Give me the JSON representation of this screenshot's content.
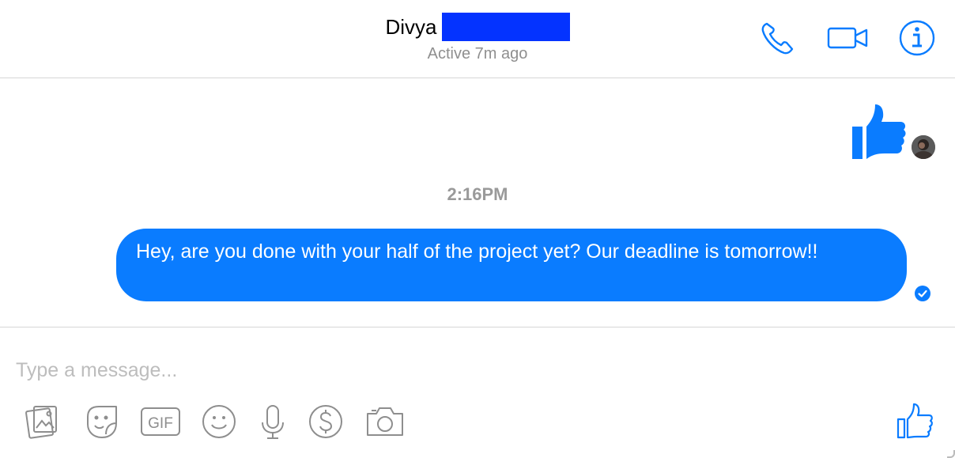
{
  "header": {
    "contact_name": "Divya",
    "redaction_color": "#0433ff",
    "status": "Active 7m ago",
    "icons": [
      "phone-icon",
      "video-camera-icon",
      "info-icon"
    ]
  },
  "thread": {
    "sticker": "thumbs-up-icon",
    "timestamp": "2:16PM",
    "message": "Hey, are you done with your half of the project yet? Our deadline is tomorrow!!",
    "status_icon": "delivered-check-icon"
  },
  "composer": {
    "placeholder": "Type a message...",
    "tools": [
      "photo-icon",
      "sticker-icon",
      "gif-icon",
      "emoji-icon",
      "microphone-icon",
      "payment-icon",
      "camera-icon"
    ],
    "gif_label": "GIF",
    "send_icon": "thumbs-up-icon"
  },
  "colors": {
    "accent": "#0a7cff",
    "icon_gray": "#8e8e8e",
    "divider": "#d6d6d6"
  }
}
